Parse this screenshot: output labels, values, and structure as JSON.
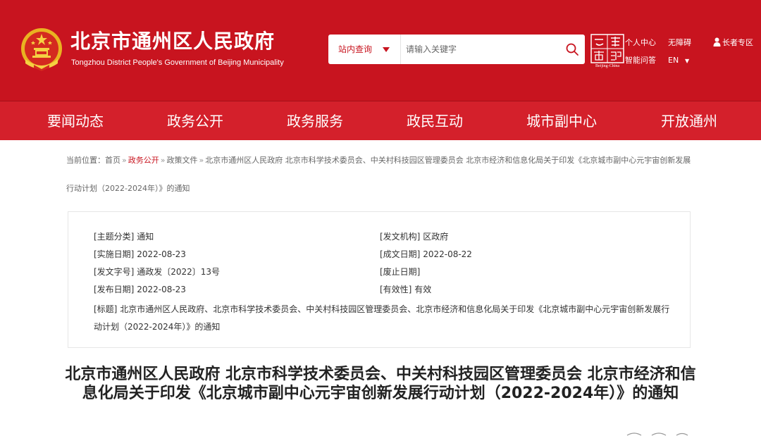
{
  "header": {
    "site_title": "北京市通州区人民政府",
    "site_subtitle": "Tongzhou District People's Government of Beijing Municipality",
    "search": {
      "scope_label": "站内查询",
      "placeholder": "请输入关键字"
    },
    "capital_logo_text": "Beijing-China",
    "links": {
      "personal_center": "个人中心",
      "accessibility": "无障碍",
      "elderly": "长者专区",
      "smart_qa": "智能问答",
      "language": "EN"
    },
    "colors": {
      "brand_red": "#c8141f",
      "nav_red": "#d4202b"
    }
  },
  "nav": {
    "items": [
      "要闻动态",
      "政务公开",
      "政务服务",
      "政民互动",
      "城市副中心",
      "开放通州"
    ]
  },
  "breadcrumb": {
    "prefix": "当前位置：",
    "home": "首页",
    "sep": "»",
    "gov_open": "政务公开",
    "docs": "政策文件",
    "current": "北京市通州区人民政府 北京市科学技术委员会、中关村科技园区管理委员会 北京市经济和信息化局关于印发《北京城市副中心元宇宙创新发展行动计划（2022-2024年）》的通知"
  },
  "info": {
    "topic_label": "[主题分类]",
    "topic_value": "通知",
    "issuer_label": "[发文机构]",
    "issuer_value": "区政府",
    "effective_label": "[实施日期]",
    "effective_value": "2022-08-23",
    "created_label": "[成文日期]",
    "created_value": "2022-08-22",
    "docno_label": "[发文字号]",
    "docno_value": "通政发〔2022〕13号",
    "abolish_label": "[废止日期]",
    "abolish_value": "",
    "published_label": "[发布日期]",
    "published_value": "2022-08-23",
    "validity_label": "[有效性]",
    "validity_value": "有效",
    "title_label": "[标题]",
    "title_value": "北京市通州区人民政府、北京市科学技术委员会、中关村科技园区管理委员会、北京市经济和信息化局关于印发《北京城市副中心元宇宙创新发展行动计划（2022-2024年）》的通知"
  },
  "article": {
    "title": "北京市通州区人民政府 北京市科学技术委员会、中关村科技园区管理委员会 北京市经济和信息化局关于印发《北京城市副中心元宇宙创新发展行动计划（2022-2024年）》的通知"
  }
}
